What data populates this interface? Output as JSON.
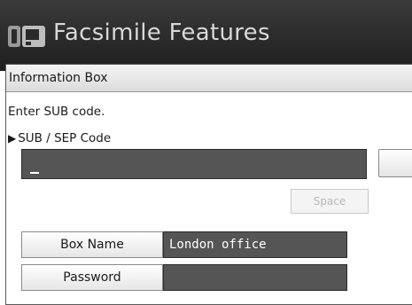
{
  "window": {
    "title": "Facsimile Features",
    "icon": "fax-machine-icon"
  },
  "panel": {
    "title": "Information Box",
    "instruction": "Enter SUB code.",
    "field_label": "SUB / SEP Code",
    "code_value": "",
    "space_label": "Space"
  },
  "box_rows": [
    {
      "label": "Box Name",
      "value": "London office"
    },
    {
      "label": "Password",
      "value": ""
    }
  ]
}
